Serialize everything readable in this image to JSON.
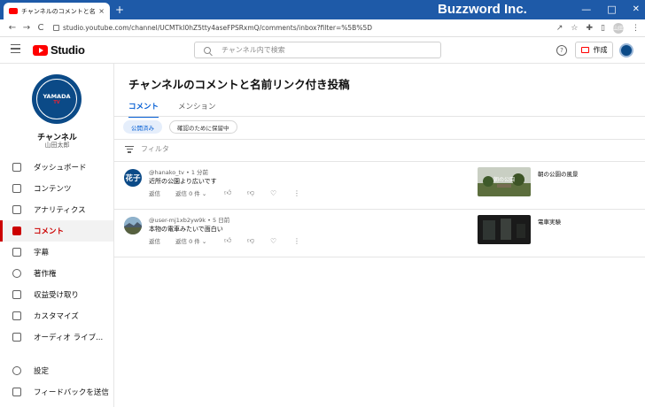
{
  "browser": {
    "tab_title": "チャンネルのコメントと名前リンク付き投",
    "tab_close": "×",
    "new_tab": "+",
    "brand": "Buzzword Inc.",
    "url": "studio.youtube.com/channel/UCMTkl0hZ5tty4aseFPSRxmQ/comments/inbox?filter=%5B%5D",
    "window_controls": [
      "—",
      "□",
      "✕"
    ],
    "nav": [
      "←",
      "→",
      "C"
    ],
    "icons": [
      "↗",
      "☆",
      "✚",
      "▯"
    ],
    "profile": "山田",
    "menu": "⋮"
  },
  "header": {
    "logo_text": "Studio",
    "search_placeholder": "チャンネル内で検索",
    "help": "?",
    "create_label": "作成"
  },
  "sidebar": {
    "avatar_line1": "YAMADA",
    "avatar_line2": "TV",
    "channel_label": "チャンネル",
    "channel_owner": "山田太郎",
    "items": [
      {
        "label": "ダッシュボード",
        "icon": "dashboard-icon"
      },
      {
        "label": "コンテンツ",
        "icon": "content-icon"
      },
      {
        "label": "アナリティクス",
        "icon": "analytics-icon"
      },
      {
        "label": "コメント",
        "icon": "comment-icon",
        "active": true
      },
      {
        "label": "字幕",
        "icon": "subtitles-icon"
      },
      {
        "label": "著作権",
        "icon": "copyright-icon"
      },
      {
        "label": "収益受け取り",
        "icon": "monetization-icon"
      },
      {
        "label": "カスタマイズ",
        "icon": "customize-icon"
      },
      {
        "label": "オーディオ ライブ...",
        "icon": "audio-library-icon"
      }
    ],
    "bottom_items": [
      {
        "label": "設定",
        "icon": "settings-icon"
      },
      {
        "label": "フィードバックを送信",
        "icon": "feedback-icon"
      }
    ]
  },
  "main": {
    "title": "チャンネルのコメントと名前リンク付き投稿",
    "tabs": [
      {
        "label": "コメント",
        "active": true
      },
      {
        "label": "メンション",
        "active": false
      }
    ],
    "chips": [
      {
        "label": "公開済み",
        "active": true
      },
      {
        "label": "確認のために保留中",
        "active": false
      }
    ],
    "filter_label": "フィルタ",
    "comments": [
      {
        "avatar_text": "花子",
        "avatar_color": "#0b4a87",
        "author": "@hanako_tv",
        "time": "1 分前",
        "text": "近所の公園より広いです",
        "reply": "返信",
        "reply_count": "返信 0 件",
        "video_title": "朝の公園の風景",
        "thumb_caption": "朝の公園"
      },
      {
        "avatar_text": "",
        "avatar_color": "#6d8aa0",
        "author": "@user-mj1xb2yw9k",
        "time": "5 日前",
        "text": "本物の電車みたいで面白い",
        "reply": "返信",
        "reply_count": "返信 0 件",
        "video_title": "電車実験",
        "thumb_caption": ""
      }
    ]
  }
}
